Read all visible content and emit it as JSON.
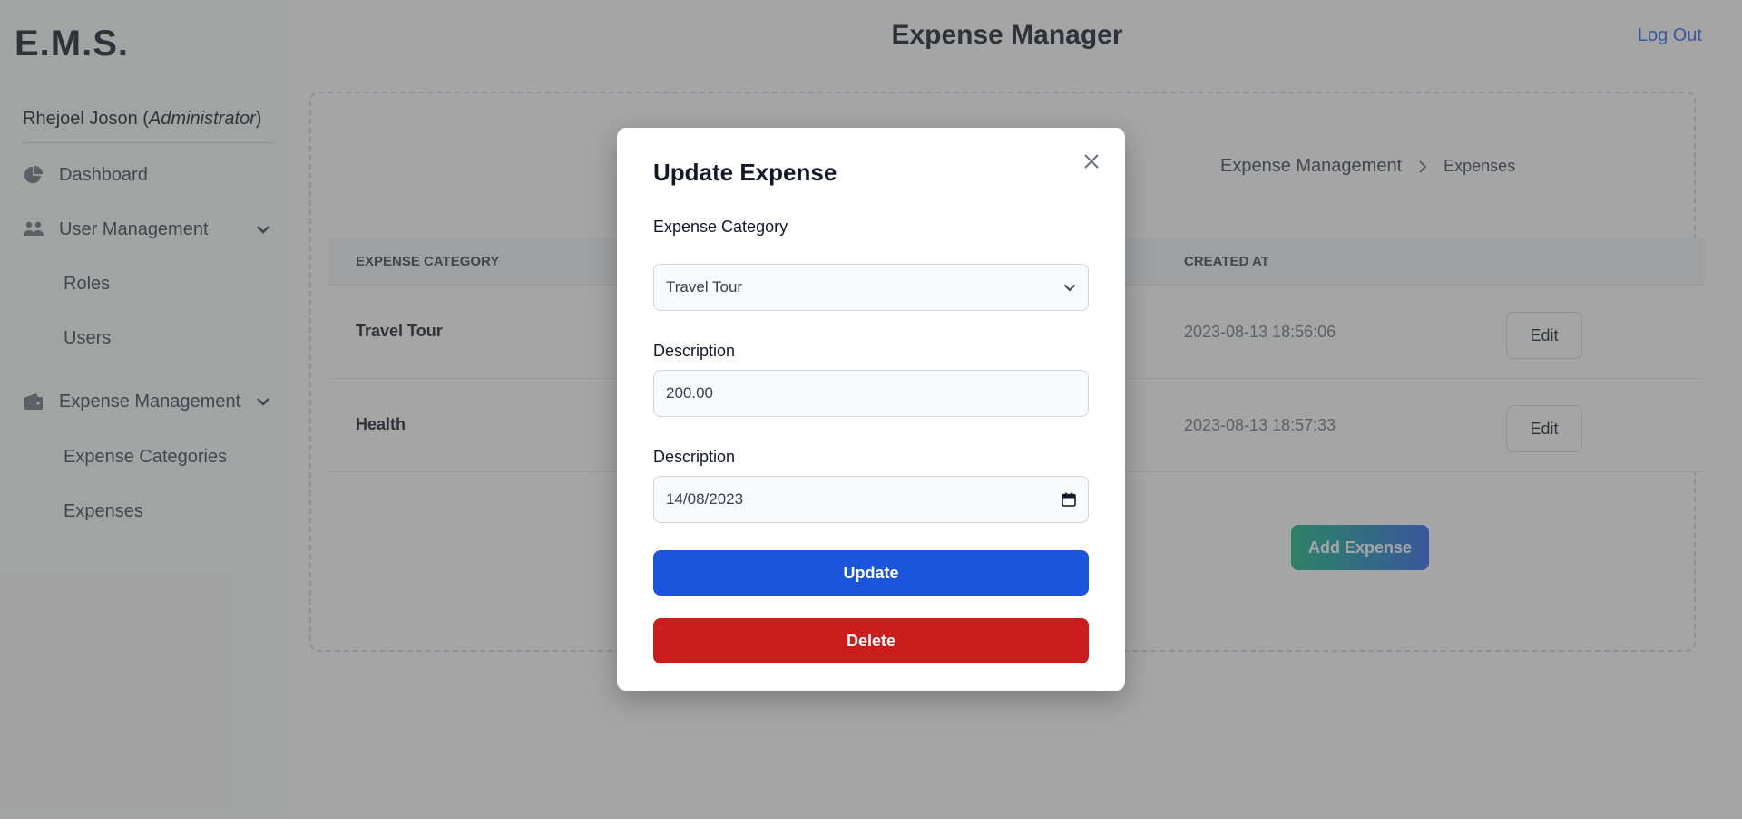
{
  "app": {
    "logo": "E.M.S.",
    "title": "Expense Manager",
    "logout": "Log Out"
  },
  "user": {
    "name": "Rhejoel Joson",
    "role": "Administrator"
  },
  "sidebar": {
    "items": [
      {
        "label": "Dashboard",
        "icon": "pie-chart-icon"
      },
      {
        "label": "User Management",
        "icon": "users-icon",
        "children": [
          {
            "label": "Roles"
          },
          {
            "label": "Users"
          }
        ]
      },
      {
        "label": "Expense Management",
        "icon": "wallet-icon",
        "children": [
          {
            "label": "Expense Categories"
          },
          {
            "label": "Expenses"
          }
        ]
      }
    ]
  },
  "breadcrumb": {
    "parent": "Expense Management",
    "current": "Expenses"
  },
  "table": {
    "headers": [
      "EXPENSE CATEGORY",
      "CREATED AT"
    ],
    "rows": [
      {
        "category": "Travel Tour",
        "created_at": "2023-08-13 18:56:06",
        "action": "Edit"
      },
      {
        "category": "Health",
        "created_at": "2023-08-13 18:57:33",
        "action": "Edit"
      }
    ]
  },
  "add_button": "Add Expense",
  "modal": {
    "title": "Update Expense",
    "category_label": "Expense Category",
    "category_value": "Travel Tour",
    "amount_label": "Description",
    "amount_value": "200.00",
    "date_label": "Description",
    "date_value": "14/08/2023",
    "update_label": "Update",
    "delete_label": "Delete"
  },
  "colors": {
    "primary": "#1a56db",
    "danger": "#c81e1e",
    "link": "#2563eb"
  }
}
